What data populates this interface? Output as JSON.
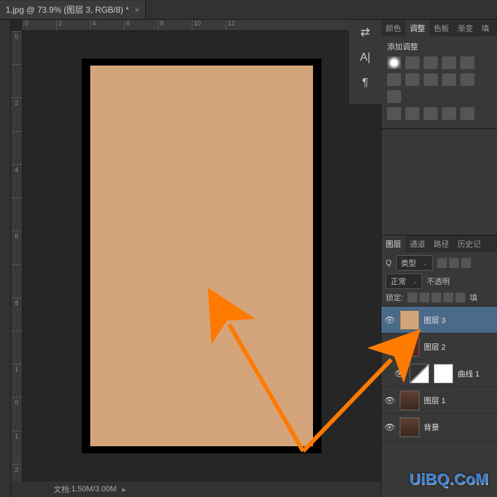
{
  "doc_tab": {
    "title": "1.jpg @ 73.9% (图层 3, RGB/8) *"
  },
  "ruler_h": [
    "0",
    "2",
    "4",
    "6",
    "8",
    "10",
    "12"
  ],
  "ruler_v": [
    "0",
    "",
    "2",
    "",
    "4",
    "",
    "6",
    "",
    "8",
    "",
    "1",
    "0",
    "1",
    "2"
  ],
  "status": {
    "label": "文档:",
    "value": "1.50M/3.00M"
  },
  "tool_dock": {
    "i1": "⇄",
    "i2": "A|",
    "i3": "¶"
  },
  "panel_tabs_top": {
    "t1": "颜色",
    "t2": "调整",
    "t3": "色板",
    "t4": "渐变",
    "t5": "填"
  },
  "adjustments": {
    "title": "添加调整"
  },
  "layers_tabs": {
    "t1": "图层",
    "t2": "通道",
    "t3": "路径",
    "t4": "历史记"
  },
  "layer_controls": {
    "type_label": "类型",
    "search_icon": "Q",
    "blend": "正常",
    "opacity_label": "不透明",
    "lock_label": "锁定:",
    "fill_label": "填"
  },
  "layers": [
    {
      "name": "图层 3",
      "thumb": "tan",
      "selected": true,
      "visible": true
    },
    {
      "name": "图层 2",
      "thumb": "dkred",
      "selected": false,
      "visible": true
    },
    {
      "name": "曲线 1",
      "thumb": "curves",
      "mask": true,
      "selected": false,
      "visible": true,
      "indent": true
    },
    {
      "name": "图层 1",
      "thumb": "photo",
      "selected": false,
      "visible": true
    },
    {
      "name": "背景",
      "thumb": "photo",
      "selected": false,
      "visible": true
    }
  ],
  "watermark": "UiBQ.CoM",
  "canvas_fill_color": "#d4a57a"
}
